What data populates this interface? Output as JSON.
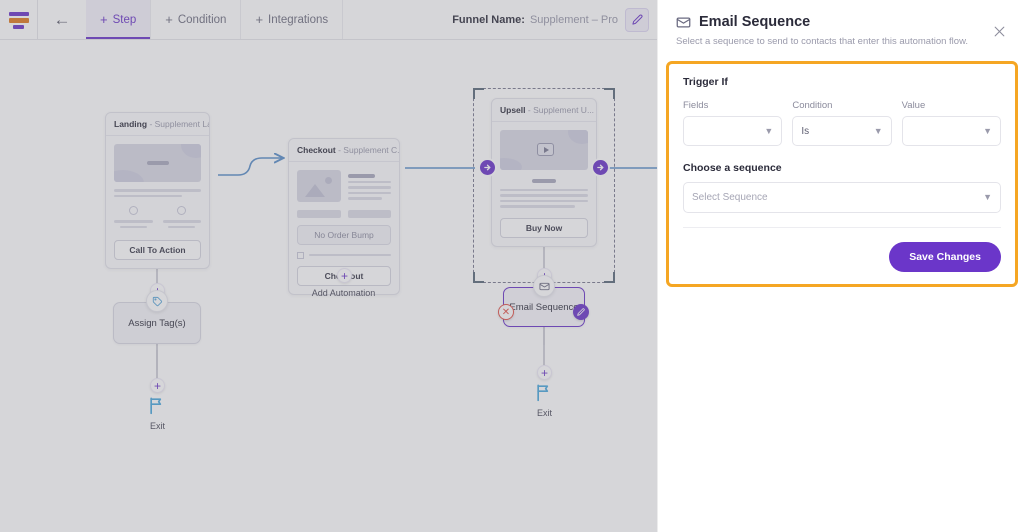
{
  "topbar": {
    "logo_icon": "funnel-logo-icon",
    "back_icon": "back-arrow-icon",
    "tabs": [
      {
        "label": "Step",
        "icon": "plus-icon",
        "active": true
      },
      {
        "label": "Condition",
        "icon": "plus-icon",
        "active": false
      },
      {
        "label": "Integrations",
        "icon": "plus-icon",
        "active": false
      }
    ],
    "funnel_name_label": "Funnel Name:",
    "funnel_name_value": "Supplement – Pro",
    "edit_icon": "pencil-icon"
  },
  "canvas": {
    "cards": [
      {
        "title": "Landing",
        "subtitle": "- Supplement La...",
        "cta_label": "Call To Action"
      },
      {
        "title": "Checkout",
        "subtitle": "- Supplement C...",
        "bump_label": "No Order Bump",
        "cta_label": "Checkout",
        "add_automation_label": "Add Automation"
      },
      {
        "title": "Upsell",
        "subtitle": "- Supplement U...",
        "cta_label": "Buy Now",
        "video_icon": "play-icon",
        "selected": true
      }
    ],
    "actions": [
      {
        "label": "Assign Tag(s)",
        "icon": "tag-icon"
      },
      {
        "label": "Email Sequence",
        "icon": "envelope-icon",
        "delete_icon": "close-icon",
        "edit_icon": "pencil-icon",
        "selected": true
      }
    ],
    "exits": [
      {
        "label": "Exit",
        "icon": "flag-icon"
      },
      {
        "label": "Exit",
        "icon": "flag-icon"
      }
    ],
    "add_step_icon": "plus-icon",
    "port_icon": "arrow-right-icon"
  },
  "panel": {
    "icon": "envelope-icon",
    "title": "Email Sequence",
    "subtitle": "Select a sequence to send to contacts that enter this automation flow.",
    "close_icon": "close-icon",
    "trigger_section_title": "Trigger If",
    "fields": [
      {
        "label": "Fields",
        "value": "",
        "placeholder": ""
      },
      {
        "label": "Condition",
        "value": "Is",
        "placeholder": ""
      },
      {
        "label": "Value",
        "value": "",
        "placeholder": ""
      }
    ],
    "sequence_section_title": "Choose a sequence",
    "sequence_placeholder": "Select Sequence",
    "save_label": "Save Changes",
    "accent_color": "#f5a623",
    "primary_color": "#6b36c9"
  }
}
